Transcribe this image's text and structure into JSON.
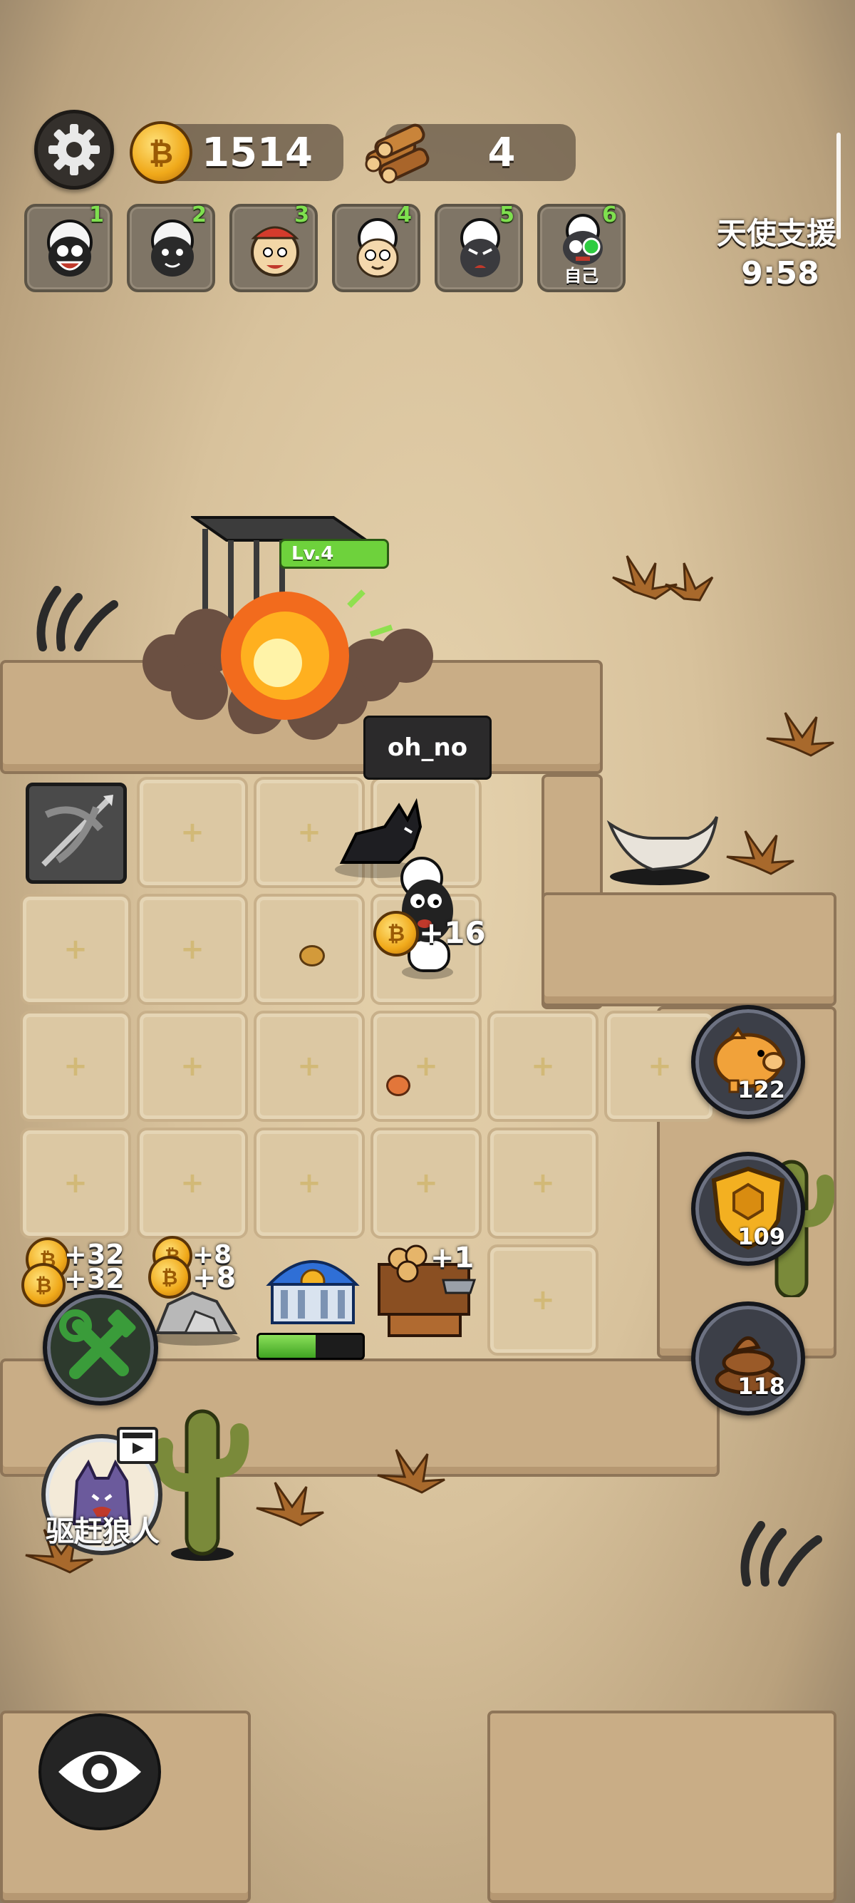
{
  "hud": {
    "coins": "1514",
    "wood": "4",
    "settings_icon": "gear-icon",
    "coin_icon": "coin-icon",
    "wood_icon": "wood-log-icon"
  },
  "players": [
    {
      "num": "1",
      "face": "black-sheep-laughing"
    },
    {
      "num": "2",
      "face": "black-sheep-smiling"
    },
    {
      "num": "3",
      "face": "sheep-red-cap"
    },
    {
      "num": "4",
      "face": "white-sheep"
    },
    {
      "num": "5",
      "face": "black-sheep-angry"
    },
    {
      "num": "6",
      "face": "robot-sheep",
      "self_label": "自己"
    }
  ],
  "angel_support": {
    "label": "天使支援",
    "timer": "9:58"
  },
  "board": {
    "cage_level": "Lv.4",
    "player_tag": "oh_no",
    "sheep_gain": "+16",
    "stone_gain_top": "+32",
    "stone_gain_bottom": "+32",
    "rock_gain_top": "+8",
    "rock_gain_bottom": "+8",
    "lumber_gain": "+1",
    "bank_progress": 0.55
  },
  "side_buttons": [
    {
      "icon": "piggy-bank-icon",
      "count": "122"
    },
    {
      "icon": "shield-icon",
      "count": "109"
    },
    {
      "icon": "poop-icon",
      "count": "118"
    }
  ],
  "actions": {
    "build_icon": "wrench-hammer-icon",
    "drive_wolf_label": "驱赶狼人",
    "drive_wolf_badge": "video-ad-icon",
    "view_icon": "eye-icon"
  },
  "colors": {
    "sand": "#e6d3ae",
    "tile": "#dcc8a3",
    "level_green": "#6ed23c",
    "coin_gold": "#f0a91a"
  }
}
